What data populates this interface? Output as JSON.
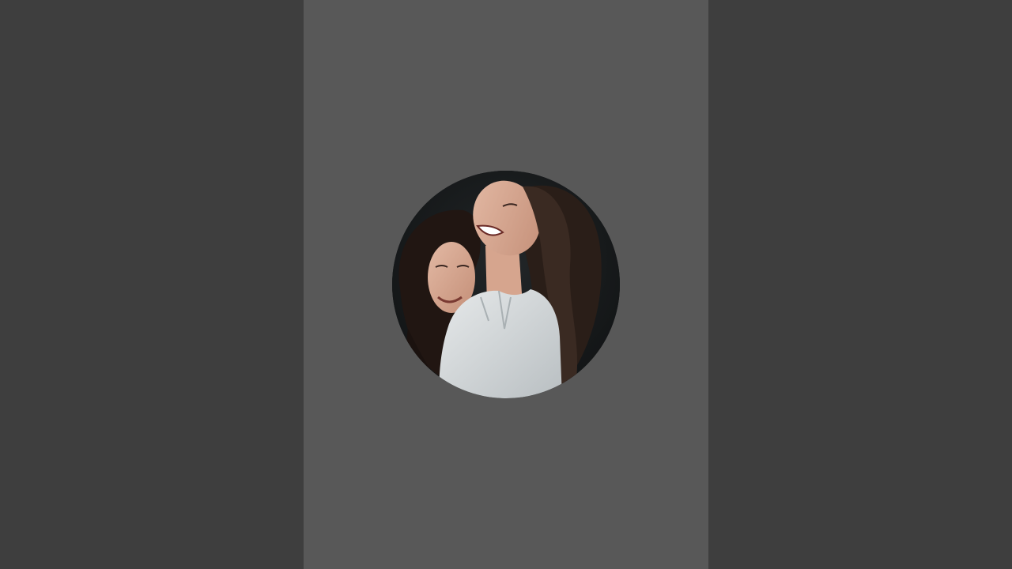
{
  "page": {
    "background_color": "#3e3e3e",
    "column_color": "#585858"
  },
  "avatar": {
    "icon": "profile-photo-avatar",
    "shape": "circle"
  }
}
